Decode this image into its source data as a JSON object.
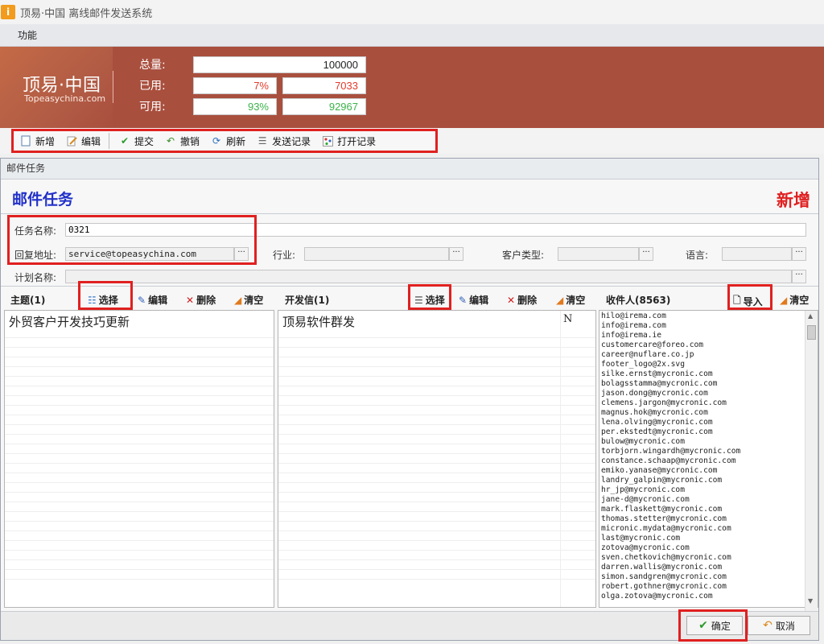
{
  "window": {
    "title": "顶易·中国 离线邮件发送系统",
    "app_icon_glyph": "i"
  },
  "menu": {
    "items": [
      "功能"
    ]
  },
  "banner": {
    "logo_main": "顶易·中国",
    "logo_sub": "Topeasychina.com",
    "stats": {
      "total_label": "总量:",
      "total_value": "100000",
      "used_label": "已用:",
      "used_percent": "7%",
      "used_value": "7033",
      "available_label": "可用:",
      "available_percent": "93%",
      "available_value": "92967"
    }
  },
  "toolbar": {
    "new": "新增",
    "edit": "编辑",
    "submit": "提交",
    "undo": "撤销",
    "refresh": "刷新",
    "send_log": "发送记录",
    "open_log": "打开记录"
  },
  "panel": {
    "header": "邮件任务",
    "title": "邮件任务",
    "mode": "新增",
    "form": {
      "task_name_label": "任务名称:",
      "task_name_value": "0321",
      "reply_label": "回复地址:",
      "reply_value": "service@topeasychina.com",
      "industry_label": "行业:",
      "customer_type_label": "客户类型:",
      "language_label": "语言:",
      "plan_label": "计划名称:",
      "dots": "···"
    },
    "subject": {
      "heading": "主题(1)",
      "select": "选择",
      "edit": "编辑",
      "delete": "删除",
      "clear": "清空",
      "items": [
        "外贸客户开发技巧更新"
      ]
    },
    "letter": {
      "heading": "开发信(1)",
      "select": "选择",
      "edit": "编辑",
      "delete": "删除",
      "clear": "清空",
      "items": [
        {
          "name": "顶易软件群发",
          "flag": "N"
        }
      ]
    },
    "recipients": {
      "heading": "收件人(8563)",
      "import": "导入",
      "clear": "清空",
      "emails": [
        "hilo@irema.com",
        "info@irema.com",
        "info@irema.ie",
        "customercare@foreo.com",
        "career@nuflare.co.jp",
        "footer_logo@2x.svg",
        "silke.ernst@mycronic.com",
        "bolagsstamma@mycronic.com",
        "jason.dong@mycronic.com",
        "clemens.jargon@mycronic.com",
        "magnus.hok@mycronic.com",
        "lena.olving@mycronic.com",
        "per.ekstedt@mycronic.com",
        "bulow@mycronic.com",
        "torbjorn.wingardh@mycronic.com",
        "constance.schaap@mycronic.com",
        "emiko.yanase@mycronic.com",
        "landry_galpin@mycronic.com",
        "hr_jp@mycronic.com",
        "jane-d@mycronic.com",
        "mark.flaskett@mycronic.com",
        "thomas.stetter@mycronic.com",
        "micronic.mydata@mycronic.com",
        "last@mycronic.com",
        "zotova@mycronic.com",
        "sven.chetkovich@mycronic.com",
        "darren.wallis@mycronic.com",
        "simon.sandgren@mycronic.com",
        "robert.gothner@mycronic.com",
        "olga.zotova@mycronic.com"
      ]
    },
    "footer": {
      "ok": "确定",
      "cancel": "取消"
    }
  },
  "colors": {
    "banner": "#a94f3e",
    "highlight": "#e02020",
    "title_blue": "#2130c8",
    "used_red": "#e23b2b",
    "available_green": "#3cb24a"
  }
}
